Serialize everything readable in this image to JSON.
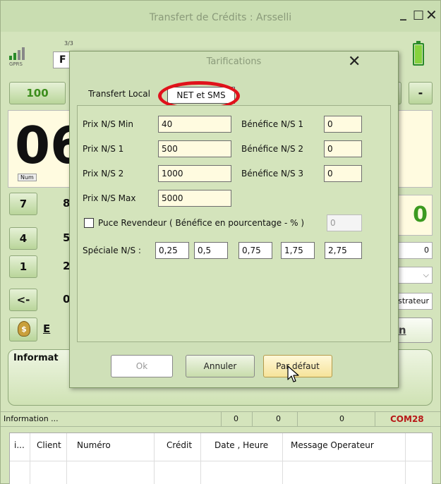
{
  "main_window": {
    "title": "Transfert de Crédits : Arsselli",
    "controls": {
      "minimize": "_",
      "maximize": "□",
      "close": "✕"
    },
    "toolbar": {
      "signal_label": "GPRS",
      "sim_label": "3/3",
      "sim_value": "F",
      "battery_level": 1.0
    },
    "amount_button": "100",
    "plus_button": "+",
    "minus_button": "-",
    "display_digits": "06",
    "num_badge": "Num",
    "keypad_keys": [
      "7",
      "4",
      "1",
      "<-"
    ],
    "keypad_partial": [
      "8",
      "5",
      "2",
      "0"
    ],
    "e_button_partial": "E",
    "balance_display": "0",
    "field_zero": "0",
    "field_combo": "",
    "field_admin": "Administrateur\"",
    "non_button": "Non",
    "info_label": "Informat",
    "status_bar": {
      "info": "Information ...",
      "val1": "0",
      "val2": "0",
      "val3": "0",
      "port": "COM28"
    },
    "table_headers": [
      "i...",
      "Client",
      "Numéro",
      "Crédit",
      "Date , Heure",
      "Message Operateur"
    ]
  },
  "dialog": {
    "title": "Tarifications",
    "close": "✕",
    "tabs": [
      "Transfert Local",
      "NET et SMS"
    ],
    "active_tab": "NET et SMS",
    "fields": {
      "prix_min_label": "Prix N/S Min",
      "prix_min_value": "40",
      "prix_1_label": "Prix N/S 1",
      "prix_1_value": "500",
      "prix_2_label": "Prix N/S 2",
      "prix_2_value": "1000",
      "prix_max_label": "Prix N/S Max",
      "prix_max_value": "5000",
      "benefice_1_label": "Bénéfice N/S 1",
      "benefice_1_value": "0",
      "benefice_2_label": "Bénéfice N/S 2",
      "benefice_2_value": "0",
      "benefice_3_label": "Bénéfice N/S 3",
      "benefice_3_value": "0"
    },
    "puce_revendeur_label": "Puce Revendeur ( Bénéfice en pourcentage - % )",
    "puce_revendeur_checked": false,
    "puce_revendeur_value": "0",
    "speciale_label": "Spéciale N/S :",
    "speciale_values": [
      "0,25",
      "0,5",
      "0,75",
      "1,75",
      "2,75"
    ],
    "buttons": {
      "ok": "Ok",
      "annuler": "Annuler",
      "defaut": "Par défaut"
    }
  }
}
